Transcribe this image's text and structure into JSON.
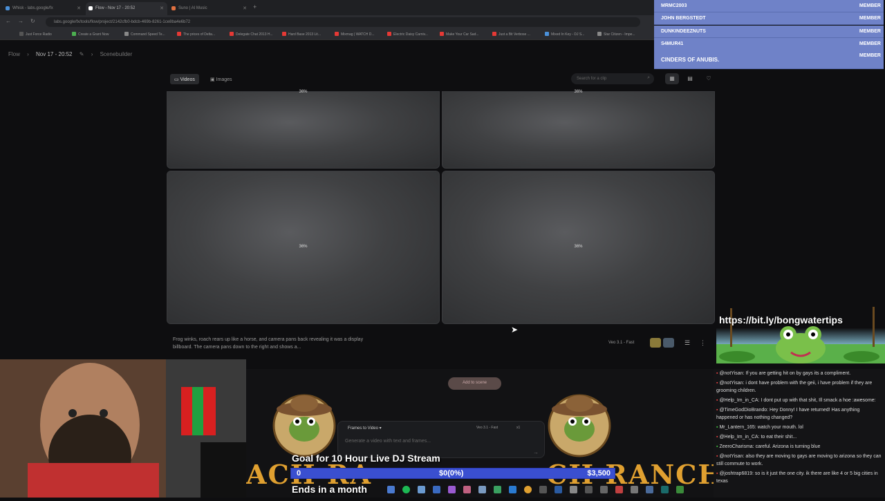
{
  "browser": {
    "tabs": [
      {
        "label": "Whisk - labs.google/fx",
        "favicon_color": "#4a90d9"
      },
      {
        "label": "Flow - Nov 17 - 20:52",
        "favicon_color": "#ffffff"
      },
      {
        "label": "Suno | AI Music",
        "favicon_color": "#e07040"
      }
    ],
    "new_tab_symbol": "+",
    "url": "labs.google/fx/tools/flow/project/2142cfb0-bdcb-469b-8261-1ce8ba4e6b72",
    "bookmarks": [
      {
        "label": "Just Force Radio",
        "color": "#555"
      },
      {
        "label": "Create a Grant Now",
        "color": "#4caf50"
      },
      {
        "label": "Command Speed Te...",
        "color": "#888"
      },
      {
        "label": "The prices of Delta...",
        "color": "#e53935"
      },
      {
        "label": "Delegate Chat 2013 H...",
        "color": "#e53935"
      },
      {
        "label": "Hard Base 2013 Lit...",
        "color": "#e53935"
      },
      {
        "label": "Mixmag | WATCH D...",
        "color": "#e53935"
      },
      {
        "label": "Electric Daisy Carniv...",
        "color": "#e53935"
      },
      {
        "label": "Make Your Car Sad...",
        "color": "#e53935"
      },
      {
        "label": "Just a Bit Verbose ...",
        "color": "#e53935"
      },
      {
        "label": "Mixed In Key - DJ S...",
        "color": "#4a90d9"
      },
      {
        "label": "Star Citizen - Impe...",
        "color": "#888"
      }
    ]
  },
  "breadcrumb": {
    "root": "Flow",
    "project": "Nov 17 - 20:52",
    "page": "Scenebuilder",
    "sep": "›",
    "edit_icon": "✎"
  },
  "media_tabs": {
    "videos": "Videos",
    "images": "Images"
  },
  "search": {
    "placeholder": "Search for a clip"
  },
  "tiles": [
    {
      "percent": "36%"
    },
    {
      "percent": "36%"
    },
    {
      "percent": "36%"
    },
    {
      "percent": "36%"
    }
  ],
  "clip": {
    "caption": "Frog winks, roach rears up like a horse, and camera pans back revealing it was a display billboard. The camera pans down to the right and shows a...",
    "model": "Veo 3.1 - Fast"
  },
  "scene": {
    "add_button": "Add to scene",
    "mode": "Frames to Video",
    "prompt_placeholder": "Generate a video with text and frames...",
    "model_small": "Veo 3.1 - Fast",
    "count": "x1",
    "ranch_left": "ACH RA",
    "ranch_right": "CH RANCH"
  },
  "members": [
    {
      "name": "MRMC2003",
      "badge": "MEMBER"
    },
    {
      "name": "JOHN BERGSTEDT",
      "badge": "MEMBER"
    },
    {
      "name": "DUNKINDEEZNUTS",
      "badge": "MEMBER"
    },
    {
      "name": "S4MUR41",
      "badge": "MEMBER"
    },
    {
      "name": "CINDERS OF ANUBIS.",
      "badge": "MEMBER"
    }
  ],
  "overlay_link": "https://bit.ly/bongwatertips",
  "chat": [
    {
      "user": "@notYisan",
      "user_color": "#6af",
      "text": "If you are getting hit on by gays its a compliment."
    },
    {
      "user": "@notYisan",
      "user_color": "#6af",
      "text": "i dont have problem with the geii, i have problem if they are grooming children."
    },
    {
      "user": "@Help_Im_in_CA",
      "user_color": "#6af",
      "text": "I dont put up with that shit, Ill smack a hoe :awesome:"
    },
    {
      "user": "@TimeGodDioBrando",
      "user_color": "#6af",
      "text": "Hey Donny! I have returned! Has anything happened or has nothing changed?"
    },
    {
      "user": "Mr_Lantern_165",
      "user_color": "#4c4",
      "text": "watch your mouth. lol"
    },
    {
      "user": "@Help_Im_in_CA",
      "user_color": "#6af",
      "text": "to eat their shit..."
    },
    {
      "user": "ZeeroCharisma",
      "user_color": "#4c4",
      "text": "careful. Arizona is turning blue"
    },
    {
      "user": "@notYisan",
      "user_color": "#6af",
      "text": "also they are moving to gays are moving to arizona so they can still commute to work."
    },
    {
      "user": "@joshtrap6819",
      "user_color": "#6af",
      "text": "so is it just the one city. ik there are like 4 or 5 big cities in texas"
    }
  ],
  "goal": {
    "title": "Goal for 10 Hour Live DJ Stream",
    "start": "0",
    "current": "$0(0%)",
    "target": "$3,500",
    "ends": "Ends in a month"
  },
  "colors": {
    "member_bg": "#6f82c8",
    "goal_bar": "#3a4fd0",
    "ranch_text": "#e0a030"
  }
}
